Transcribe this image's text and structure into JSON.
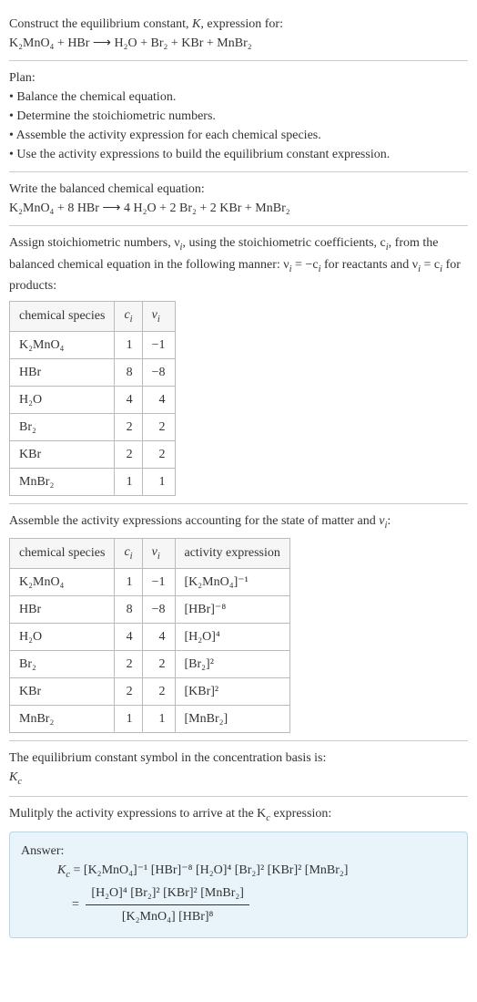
{
  "intro": {
    "line1": "Construct the equilibrium constant, K, expression for:",
    "equation": "K₂MnO₄ + HBr ⟶ H₂O + Br₂ + KBr + MnBr₂"
  },
  "plan": {
    "heading": "Plan:",
    "items": [
      "• Balance the chemical equation.",
      "• Determine the stoichiometric numbers.",
      "• Assemble the activity expression for each chemical species.",
      "• Use the activity expressions to build the equilibrium constant expression."
    ]
  },
  "balanced": {
    "heading": "Write the balanced chemical equation:",
    "equation": "K₂MnO₄ + 8 HBr ⟶ 4 H₂O + 2 Br₂ + 2 KBr + MnBr₂"
  },
  "assign": {
    "text_a": "Assign stoichiometric numbers, ν",
    "text_b": ", using the stoichiometric coefficients, c",
    "text_c": ", from the balanced chemical equation in the following manner: ν",
    "text_d": " = −c",
    "text_e": " for reactants and ν",
    "text_f": " = c",
    "text_g": " for products:",
    "headers": [
      "chemical species",
      "cᵢ",
      "νᵢ"
    ],
    "rows": [
      {
        "species": "K₂MnO₄",
        "c": "1",
        "v": "−1"
      },
      {
        "species": "HBr",
        "c": "8",
        "v": "−8"
      },
      {
        "species": "H₂O",
        "c": "4",
        "v": "4"
      },
      {
        "species": "Br₂",
        "c": "2",
        "v": "2"
      },
      {
        "species": "KBr",
        "c": "2",
        "v": "2"
      },
      {
        "species": "MnBr₂",
        "c": "1",
        "v": "1"
      }
    ]
  },
  "activity": {
    "heading": "Assemble the activity expressions accounting for the state of matter and νᵢ:",
    "headers": [
      "chemical species",
      "cᵢ",
      "νᵢ",
      "activity expression"
    ],
    "rows": [
      {
        "species": "K₂MnO₄",
        "c": "1",
        "v": "−1",
        "expr": "[K₂MnO₄]⁻¹"
      },
      {
        "species": "HBr",
        "c": "8",
        "v": "−8",
        "expr": "[HBr]⁻⁸"
      },
      {
        "species": "H₂O",
        "c": "4",
        "v": "4",
        "expr": "[H₂O]⁴"
      },
      {
        "species": "Br₂",
        "c": "2",
        "v": "2",
        "expr": "[Br₂]²"
      },
      {
        "species": "KBr",
        "c": "2",
        "v": "2",
        "expr": "[KBr]²"
      },
      {
        "species": "MnBr₂",
        "c": "1",
        "v": "1",
        "expr": "[MnBr₂]"
      }
    ]
  },
  "basis": {
    "line1": "The equilibrium constant symbol in the concentration basis is:",
    "symbol": "K",
    "sub": "c"
  },
  "multiply": {
    "heading_a": "Mulitply the activity expressions to arrive at the K",
    "heading_b": " expression:"
  },
  "answer": {
    "label": "Answer:",
    "lhs_sym": "K",
    "lhs_sub": "c",
    "eq1": " = [K₂MnO₄]⁻¹ [HBr]⁻⁸ [H₂O]⁴ [Br₂]² [KBr]² [MnBr₂]",
    "eq2_prefix": "= ",
    "frac_num": "[H₂O]⁴ [Br₂]² [KBr]² [MnBr₂]",
    "frac_den": "[K₂MnO₄] [HBr]⁸"
  }
}
